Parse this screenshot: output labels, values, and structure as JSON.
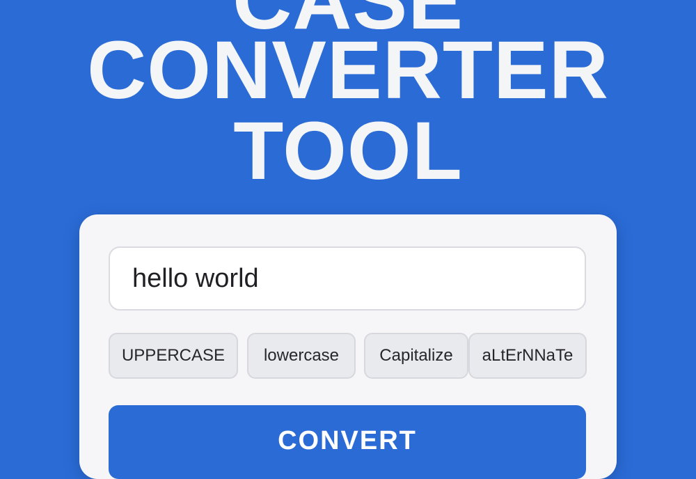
{
  "title": {
    "line1": "CASE",
    "line2": "CONVERTER",
    "line3": "TOOL"
  },
  "input": {
    "value": "hello world"
  },
  "options": {
    "uppercase": "UPPERCASE",
    "lowercase": "lowercase",
    "capitalize": "Capitalize",
    "alternate": "aLtErNNaTe"
  },
  "convert_label": "CONVERT",
  "colors": {
    "background": "#2a6bd6",
    "card": "#f6f6f8",
    "button": "#2a6bd6"
  }
}
